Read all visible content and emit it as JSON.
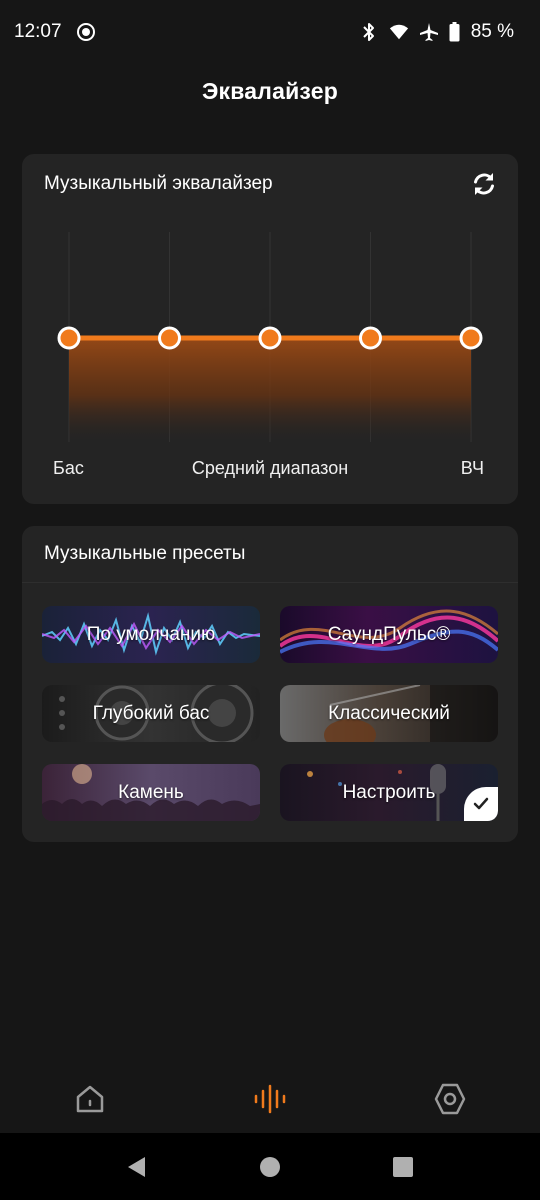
{
  "status_bar": {
    "time": "12:07",
    "battery": "85 %",
    "icons": [
      "record-icon",
      "bluetooth-icon",
      "wifi-icon",
      "airplane-icon",
      "battery-icon"
    ]
  },
  "header": {
    "title": "Эквалайзер"
  },
  "equalizer": {
    "title": "Музыкальный эквалайзер",
    "reset_icon": "refresh-icon",
    "bands": [
      {
        "level": 0
      },
      {
        "level": 0
      },
      {
        "level": 0
      },
      {
        "level": 0
      },
      {
        "level": 0
      }
    ],
    "level_range": [
      -1,
      1
    ],
    "labels": {
      "bass": "Бас",
      "mid": "Средний диапазон",
      "treble": "ВЧ"
    },
    "accent_color": "#f07a1c"
  },
  "presets": {
    "title": "Музыкальные пресеты",
    "items": [
      {
        "label": "По умолчанию"
      },
      {
        "label": "СаундПульс®"
      },
      {
        "label": "Глубокий бас"
      },
      {
        "label": "Классический"
      },
      {
        "label": "Камень"
      },
      {
        "label": "Настроить"
      }
    ],
    "selected": "Настроить"
  },
  "bottom_nav": {
    "items": [
      "home-icon",
      "equalizer-icon",
      "settings-icon"
    ],
    "active": "equalizer-icon",
    "active_color": "#f07a1c"
  },
  "system_nav": [
    "back-icon",
    "home-circle-icon",
    "recents-icon"
  ]
}
